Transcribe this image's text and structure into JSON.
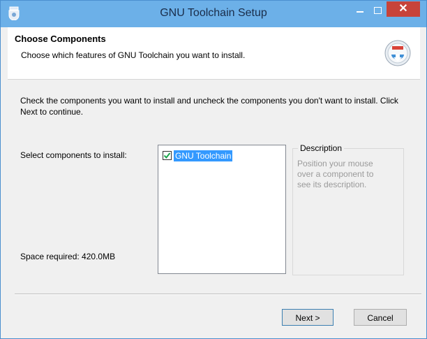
{
  "window": {
    "title": "GNU Toolchain Setup",
    "close_glyph": "✕"
  },
  "header": {
    "title": "Choose Components",
    "subtitle": "Choose which features of GNU Toolchain you want to install.",
    "logo_icon": "installer-disk-icon"
  },
  "main": {
    "intro": "Check the components you want to install and uncheck the components you don't want to install. Click Next to continue.",
    "select_label": "Select components to install:",
    "space_required": "Space required: 420.0MB",
    "components": [
      {
        "label": "GNU Toolchain",
        "checked": true,
        "selected": true
      }
    ],
    "description": {
      "legend": "Description",
      "text": "Position your mouse over a component to see its description."
    }
  },
  "buttons": {
    "next_label": "Next >",
    "cancel_label": "Cancel"
  },
  "colors": {
    "titlebar": "#6cb0e8",
    "close_button": "#c7433a",
    "selection": "#3399ff"
  }
}
